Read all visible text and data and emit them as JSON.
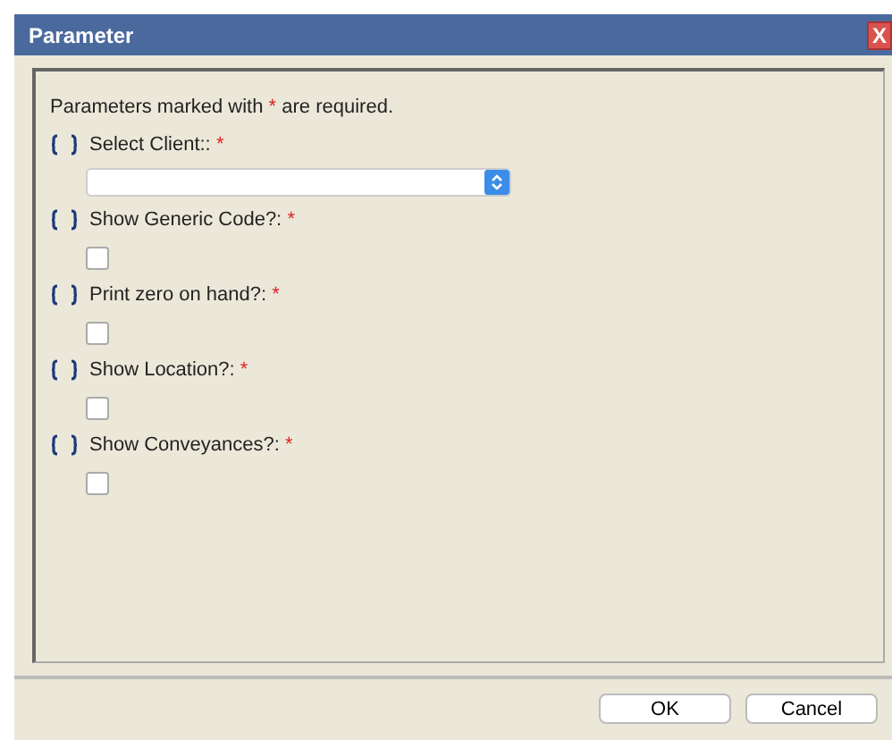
{
  "window": {
    "title": "Parameter",
    "close": "X"
  },
  "notice": {
    "before": "Parameters marked with",
    "mark": "*",
    "after": "are required."
  },
  "parameters": [
    {
      "kind": "select",
      "label": "Select Client::",
      "required_mark": "*"
    },
    {
      "kind": "checkbox",
      "label": "Show Generic Code?:",
      "required_mark": "*",
      "checked": false
    },
    {
      "kind": "checkbox",
      "label": "Print zero on hand?:",
      "required_mark": "*",
      "checked": false
    },
    {
      "kind": "checkbox",
      "label": "Show Location?:",
      "required_mark": "*",
      "checked": false
    },
    {
      "kind": "checkbox",
      "label": "Show Conveyances?:",
      "required_mark": "*",
      "checked": false
    }
  ],
  "buttons": [
    "OK",
    "Cancel"
  ]
}
